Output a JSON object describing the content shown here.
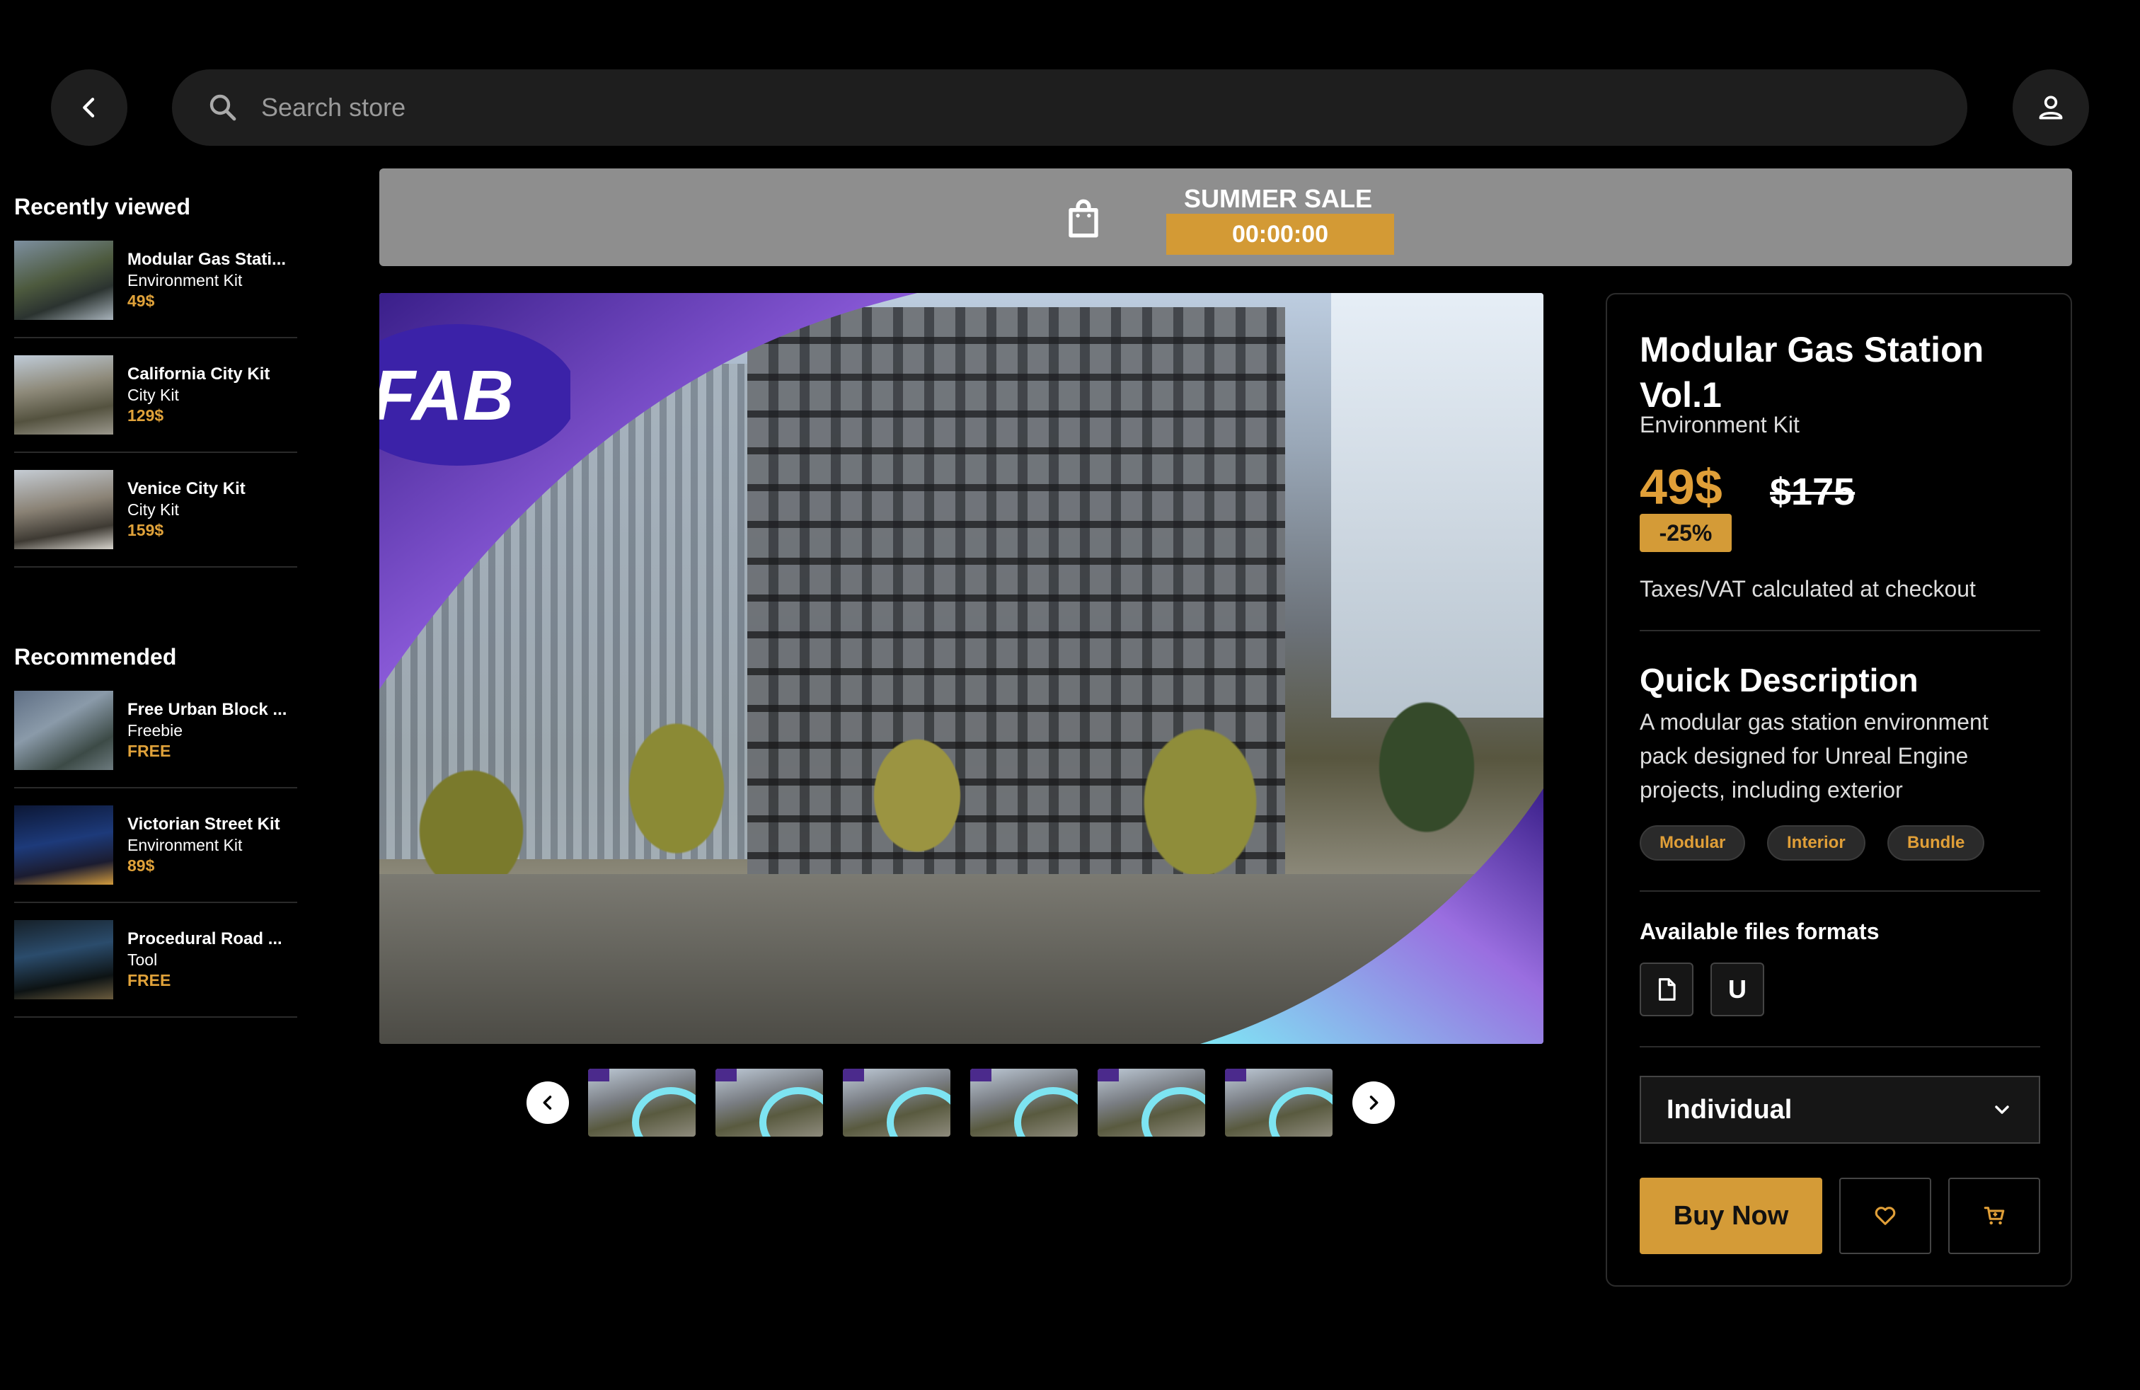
{
  "header": {
    "search": {
      "placeholder": "Search store"
    },
    "icons": {
      "back": "chevron-left-icon",
      "search": "search-icon",
      "profile": "user-icon"
    }
  },
  "sidebar": {
    "recently_viewed": {
      "heading": "Recently viewed",
      "items": [
        {
          "title": "Modular Gas Stati...",
          "category": "Environment Kit",
          "price": "49$"
        },
        {
          "title": "California City Kit",
          "category": "City Kit",
          "price": "129$"
        },
        {
          "title": "Venice City Kit",
          "category": "City Kit",
          "price": "159$"
        }
      ]
    },
    "recommended": {
      "heading": "Recommended",
      "items": [
        {
          "title": "Free Urban Block ...",
          "category": "Freebie",
          "price": "FREE"
        },
        {
          "title": "Victorian Street Kit",
          "category": "Environment Kit",
          "price": "89$"
        },
        {
          "title": "Procedural Road ...",
          "category": "Tool",
          "price": "FREE"
        }
      ]
    }
  },
  "banner": {
    "title": "SUMMER SALE",
    "timer": "00:00:00",
    "icon": "shopping-bag-icon"
  },
  "gallery": {
    "logo_text": "FAB",
    "thumbnail_count": 6,
    "icons": {
      "prev": "chevron-left-icon",
      "next": "chevron-right-icon"
    }
  },
  "product": {
    "title": "Modular Gas Station Vol.1",
    "category": "Environment Kit",
    "price": "49$",
    "original_price": "$175",
    "discount": "-25%",
    "tax_note": "Taxes/VAT calculated at checkout",
    "quick_description_heading": "Quick Description",
    "quick_description": "A modular gas station environment pack designed for Unreal Engine projects, including exterior",
    "tags": [
      "Modular",
      "Interior",
      "Bundle"
    ],
    "formats_heading": "Available files formats",
    "formats": [
      {
        "icon": "file-icon",
        "label": ""
      },
      {
        "icon": "unreal-engine-icon",
        "label": "U"
      }
    ],
    "license_select": "Individual",
    "buy_label": "Buy Now",
    "icons": {
      "wishlist": "heart-icon",
      "cart": "cart-icon",
      "select": "chevron-down-icon"
    }
  },
  "colors": {
    "accent": "#D49B37",
    "background": "#000000",
    "surface": "#1E1E1E",
    "banner": "#8E8E8E"
  }
}
